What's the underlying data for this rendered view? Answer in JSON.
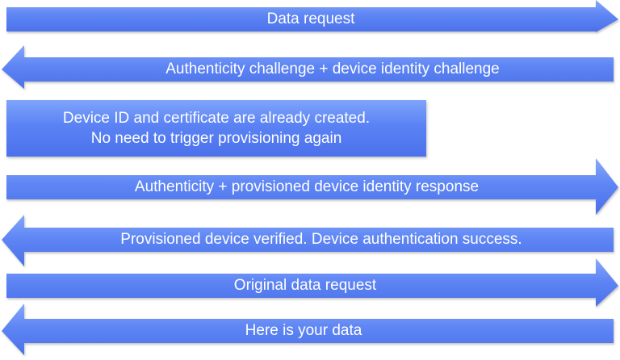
{
  "colors": {
    "arrow_top": "#86a9fb",
    "arrow_mid": "#5f86f4",
    "arrow_bottom": "#4a70ea",
    "text": "#ffffff",
    "background": "#ffffff"
  },
  "messages": [
    {
      "label": "Data request",
      "direction": "right"
    },
    {
      "label": "Authenticity challenge + device identity challenge",
      "direction": "left"
    },
    {
      "label": "Authenticity + provisioned device identity response",
      "direction": "right"
    },
    {
      "label": "Provisioned device verified. Device authentication success.",
      "direction": "left"
    },
    {
      "label": "Original data request",
      "direction": "right"
    },
    {
      "label": "Here is your data",
      "direction": "left"
    }
  ],
  "note": {
    "line1": "Device ID and certificate are already created.",
    "line2": "No need to trigger provisioning again"
  }
}
